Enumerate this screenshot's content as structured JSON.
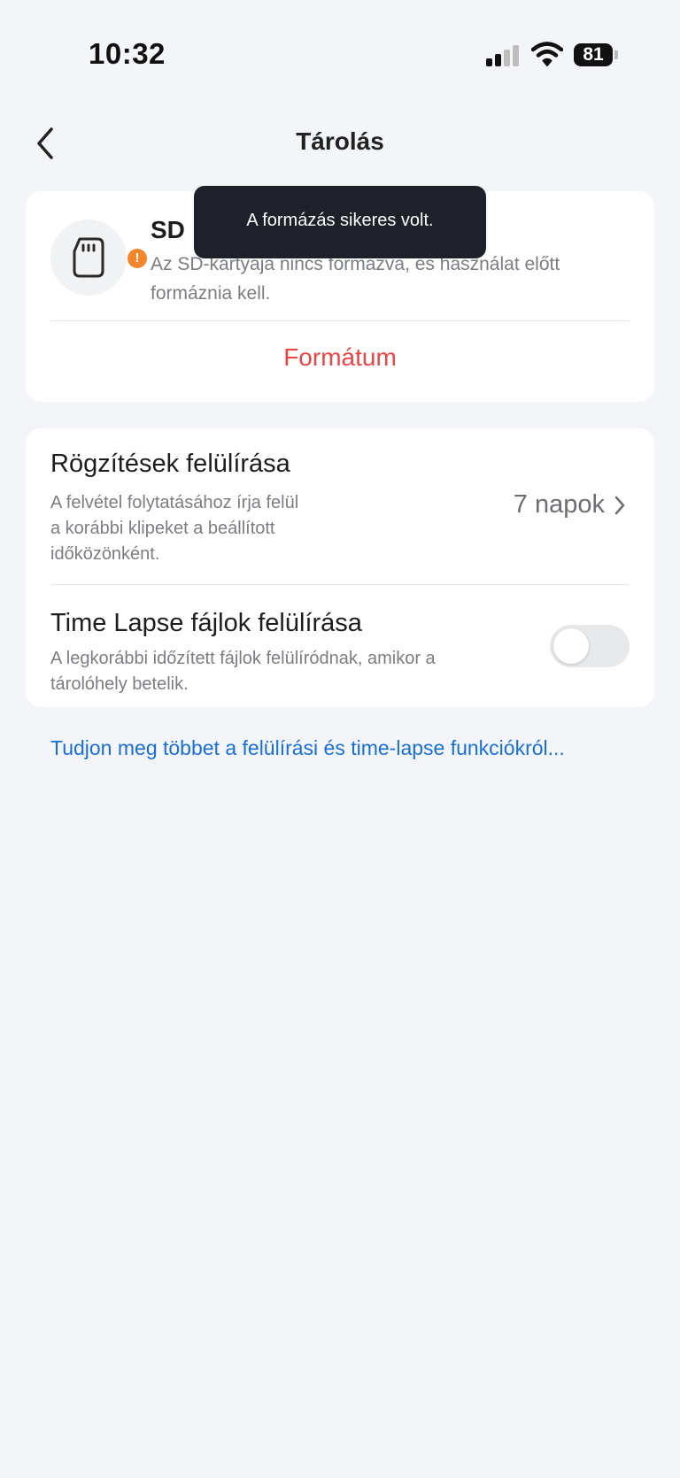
{
  "status_bar": {
    "time": "10:32",
    "battery_level": "81",
    "signal_bars_active": 2,
    "signal_bars_total": 4
  },
  "header": {
    "title": "Tárolás",
    "back_icon": "chevron-left-icon"
  },
  "sd_card": {
    "title": "SD",
    "description": "Az SD-kártyája nincs formázva, és használat előtt formáznia kell.",
    "icon": "sd-card-icon",
    "badge": "!",
    "format_label": "Formátum"
  },
  "settings": {
    "overwrite": {
      "title": "Rögzítések felülírása",
      "description_lines": [
        "A felvétel folytatásához írja felül",
        "a korábbi klipeket a beállított",
        "időközönként."
      ],
      "value": "7 napok"
    },
    "timelapse": {
      "title": "Time Lapse fájlok felülírása",
      "description_lines": [
        "A legkorábbi időzített fájlok felülíródnak, amikor a",
        "tárolóhely betelik."
      ],
      "enabled": false
    }
  },
  "learn_more": "Tudjon meg többet a felülírási és time-lapse funkciókról...",
  "toast": {
    "message": "A formázás sikeres volt."
  },
  "colors": {
    "accent_red": "#e84545",
    "link_blue": "#1a6fd6",
    "badge_orange": "#f5852a",
    "background": "#f3f5f8"
  }
}
